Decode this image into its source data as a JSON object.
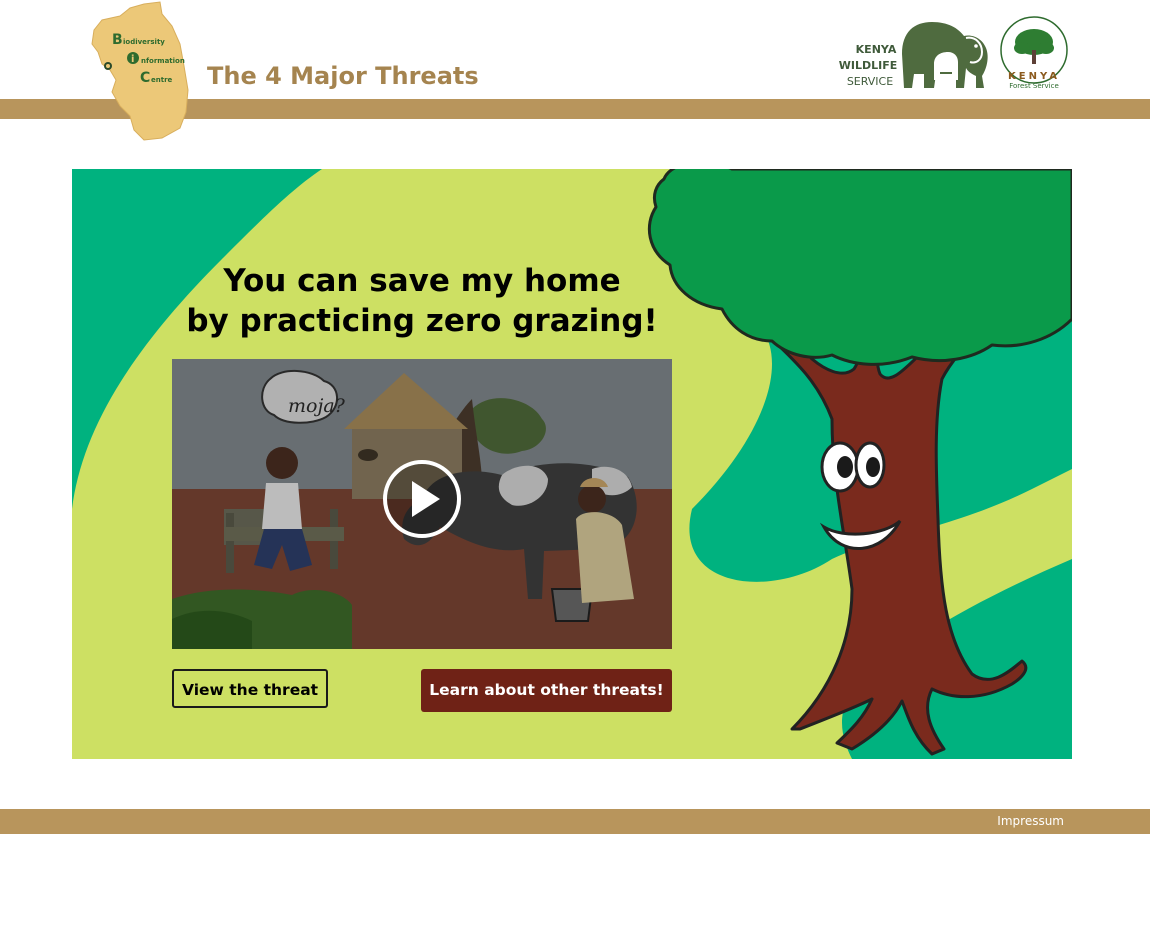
{
  "header": {
    "title": "The 4 Major Threats",
    "logo": {
      "letters": [
        "B",
        "i",
        "C"
      ],
      "words": [
        "iodiversity",
        "nformation",
        "entre"
      ]
    },
    "partners": {
      "kws": {
        "lines": [
          "KENYA",
          "WILDLIFE",
          "SERVICE"
        ]
      },
      "kfs": {
        "name": "KENYA",
        "subtitle": "Forest Service"
      }
    }
  },
  "hero": {
    "headline_line1": "You can save my home",
    "headline_line2": "by practicing zero grazing!",
    "video": {
      "bubble_text": "moja?",
      "play_icon": "play-icon"
    },
    "view_button": "View the threat",
    "learn_button": "Learn about other threats!"
  },
  "footer": {
    "impressum": "Impressum"
  },
  "colors": {
    "band": "#b8955c",
    "title": "#a5844f",
    "hero_green": "#00b27f",
    "hero_lime": "#cde063",
    "tree_trunk": "#7a2a1d",
    "tree_canopy": "#0a9a4a",
    "learn_button": "#6f2216"
  }
}
